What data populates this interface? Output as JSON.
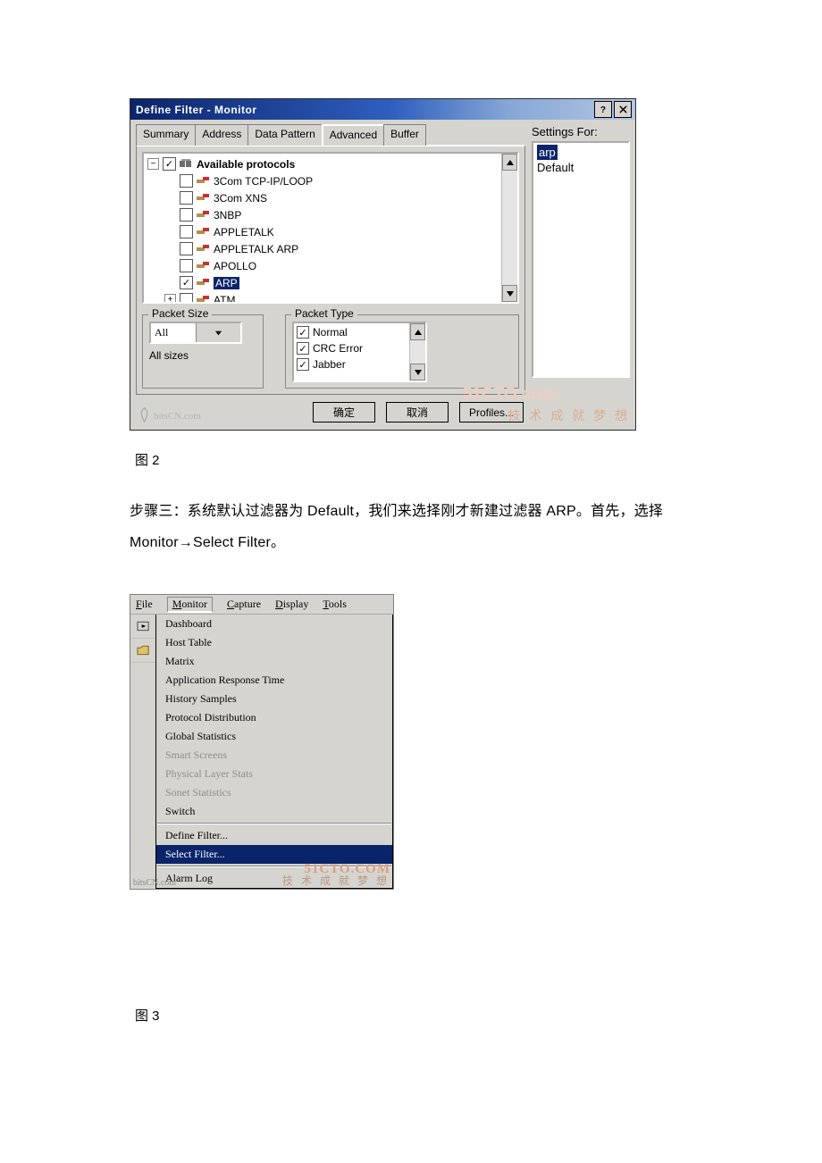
{
  "dlg": {
    "title": "Define Filter - Monitor",
    "tabs": [
      "Summary",
      "Address",
      "Data Pattern",
      "Advanced",
      "Buffer"
    ],
    "tree": {
      "root": "Available protocols",
      "items": [
        "3Com TCP-IP/LOOP",
        "3Com XNS",
        "3NBP",
        "APPLETALK",
        "APPLETALK ARP",
        "APOLLO",
        "ARP",
        "ATM"
      ]
    },
    "size_group": "Packet Size",
    "size_value": "All",
    "size_note": "All sizes",
    "type_group": "Packet Type",
    "types": [
      "Normal",
      "CRC Error",
      "Jabber"
    ],
    "settings_for": "Settings For:",
    "settings": [
      "arp",
      "Default"
    ],
    "btn_ok": "确定",
    "btn_cancel": "取消",
    "btn_profiles": "Profiles...",
    "wm1": "技 术 成 就 梦 想",
    "wmsite": "bitsCN.com"
  },
  "cap1": "图 2",
  "cap2": "图 3",
  "para": "步骤三：系统默认过滤器为 Default，我们来选择刚才新建过滤器 ARP。首先，选择Monitor→Select Filter。",
  "menu": {
    "bar": [
      "File",
      "Monitor",
      "Capture",
      "Display",
      "Tools"
    ],
    "items": [
      {
        "t": "Dashboard"
      },
      {
        "t": "Host Table"
      },
      {
        "t": "Matrix"
      },
      {
        "t": "Application Response Time"
      },
      {
        "t": "History Samples"
      },
      {
        "t": "Protocol Distribution"
      },
      {
        "t": "Global Statistics"
      },
      {
        "t": "Smart Screens",
        "d": true
      },
      {
        "t": "Physical Layer Stats",
        "d": true
      },
      {
        "t": "Sonet Statistics",
        "d": true
      },
      {
        "t": "Switch"
      },
      {
        "sep": true
      },
      {
        "t": "Define Filter..."
      },
      {
        "t": "Select Filter...",
        "sel": true
      },
      {
        "sep": true
      },
      {
        "t": "Alarm Log"
      }
    ],
    "wmsite": "bitsCN.com"
  }
}
